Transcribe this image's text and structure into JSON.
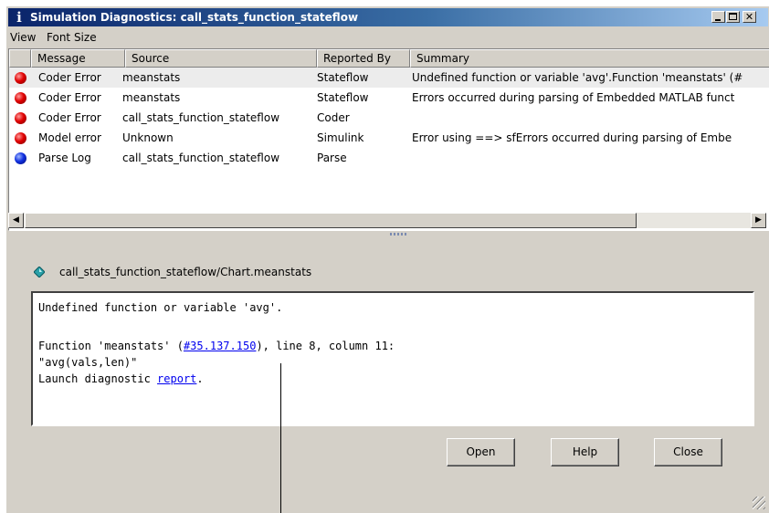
{
  "window": {
    "title": "Simulation Diagnostics: call_stats_function_stateflow",
    "title_icon": "info-icon"
  },
  "menu": [
    "View",
    "Font Size"
  ],
  "table": {
    "columns": [
      "Message",
      "Source",
      "Reported By",
      "Summary"
    ],
    "rows": [
      {
        "icon": "red",
        "message": "Coder Error",
        "source": "meanstats",
        "reported_by": "Stateflow",
        "summary": "Undefined function or variable 'avg'.Function 'meanstats' (#",
        "selected": true
      },
      {
        "icon": "red",
        "message": "Coder Error",
        "source": "meanstats",
        "reported_by": "Stateflow",
        "summary": "Errors occurred during parsing of Embedded MATLAB funct",
        "selected": false
      },
      {
        "icon": "red",
        "message": "Coder Error",
        "source": "call_stats_function_stateflow",
        "reported_by": "Coder",
        "summary": "",
        "selected": false
      },
      {
        "icon": "red",
        "message": "Model error",
        "source": "Unknown",
        "reported_by": "Simulink",
        "summary": "Error using ==> sfErrors occurred during parsing of Embe",
        "selected": false
      },
      {
        "icon": "blue",
        "message": "Parse Log",
        "source": "call_stats_function_stateflow",
        "reported_by": "Parse",
        "summary": "",
        "selected": false
      }
    ]
  },
  "detail": {
    "path": "call_stats_function_stateflow/Chart.meanstats",
    "line1": "Undefined function or variable 'avg'.",
    "line2_prefix": "Function 'meanstats' (",
    "line2_link": "#35.137.150",
    "line2_suffix": "), line 8, column 11:",
    "line3": "\"avg(vals,len)\"",
    "line4_prefix": "Launch diagnostic ",
    "line4_link": "report",
    "line4_suffix": "."
  },
  "buttons": {
    "open": "Open",
    "help": "Help",
    "close": "Close"
  },
  "colors": {
    "title_start": "#0a246a",
    "title_end": "#a6caf0",
    "error": "#e00000",
    "info": "#1030e0",
    "link": "#0000ee"
  }
}
